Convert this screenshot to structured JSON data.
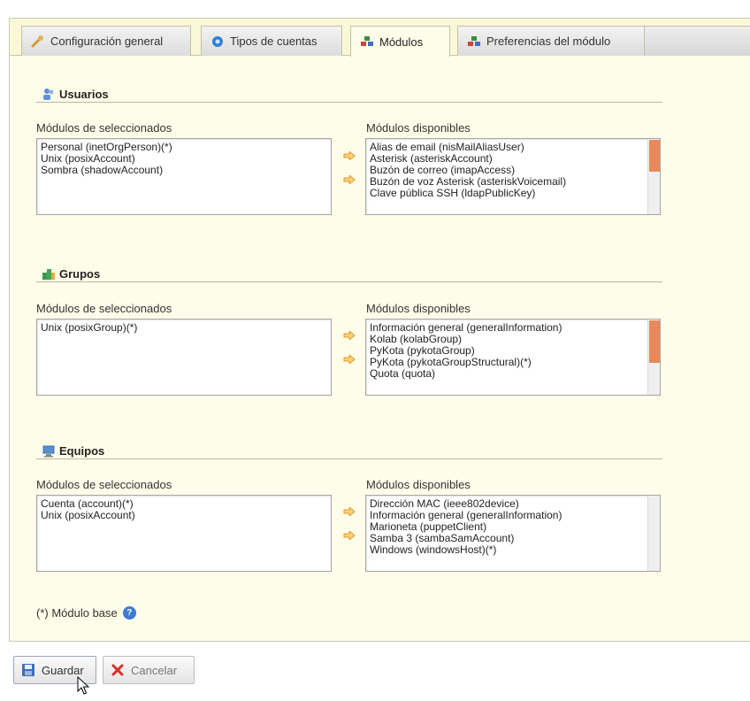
{
  "tabs": [
    {
      "label": "Configuración general",
      "icon": "wrench-icon"
    },
    {
      "label": "Tipos de cuentas",
      "icon": "account-types-icon"
    },
    {
      "label": "Módulos",
      "icon": "modules-icon",
      "active": true
    },
    {
      "label": "Preferencias del módulo",
      "icon": "module-preferences-icon"
    }
  ],
  "sections": {
    "users": {
      "title": "Usuarios",
      "selected_label": "Módulos de seleccionados",
      "available_label": "Módulos disponibles",
      "selected": [
        "Personal (inetOrgPerson)(*)",
        "Unix (posixAccount)",
        "Sombra (shadowAccount)"
      ],
      "available": [
        "Alias de email (nisMailAliasUser)",
        "Asterisk (asteriskAccount)",
        "Buzón de correo (imapAccess)",
        "Buzón de voz Asterisk (asteriskVoicemail)",
        "Clave pública SSH (ldapPublicKey)"
      ]
    },
    "groups": {
      "title": "Grupos",
      "selected_label": "Módulos de seleccionados",
      "available_label": "Módulos disponibles",
      "selected": [
        "Unix (posixGroup)(*)"
      ],
      "available": [
        "Información general (generalInformation)",
        "Kolab (kolabGroup)",
        "PyKota (pykotaGroup)",
        "PyKota (pykotaGroupStructural)(*)",
        "Quota (quota)"
      ]
    },
    "hosts": {
      "title": "Equipos",
      "selected_label": "Módulos de seleccionados",
      "available_label": "Módulos disponibles",
      "selected": [
        "Cuenta (account)(*)",
        "Unix (posixAccount)"
      ],
      "available": [
        "Dirección MAC (ieee802device)",
        "Información general (generalInformation)",
        "Marioneta (puppetClient)",
        "Samba 3 (sambaSamAccount)",
        "Windows (windowsHost)(*)"
      ]
    }
  },
  "footnote": "(*) Módulo base",
  "buttons": {
    "save": "Guardar",
    "cancel": "Cancelar"
  },
  "colors": {
    "panel_bg": "#fefde9",
    "scroll_thumb": "#e9885a",
    "arrow": "#f0a23a",
    "help": "#3d7bd6"
  }
}
